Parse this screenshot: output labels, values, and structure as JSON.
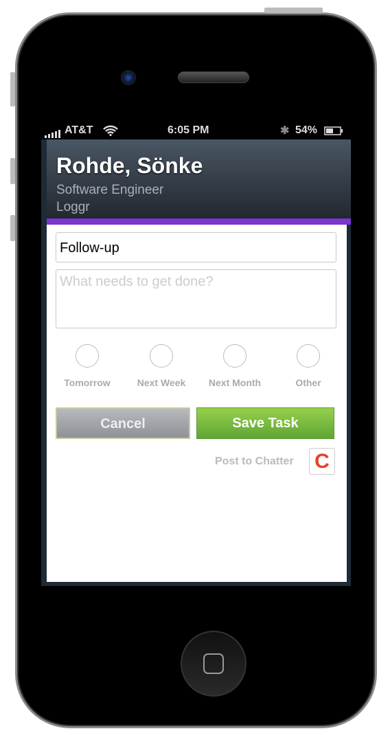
{
  "status": {
    "carrier": "AT&T",
    "time": "6:05 PM",
    "battery": "54%",
    "battery_level": 0.54
  },
  "contact": {
    "name": "Rohde, Sönke",
    "title": "Software Engineer",
    "company": "Loggr"
  },
  "form": {
    "subject_value": "Follow-up",
    "description_placeholder": "What needs to get done?",
    "due_options": [
      {
        "label": "Tomorrow",
        "selected": false
      },
      {
        "label": "Next Week",
        "selected": false
      },
      {
        "label": "Next Month",
        "selected": false
      },
      {
        "label": "Other",
        "selected": false
      }
    ],
    "cancel_label": "Cancel",
    "save_label": "Save Task",
    "chatter_label": "Post to Chatter",
    "chatter_icon_letter": "C"
  },
  "colors": {
    "accent": "#7b35cf",
    "save": "#6db33f",
    "chatter": "#e8402a"
  }
}
